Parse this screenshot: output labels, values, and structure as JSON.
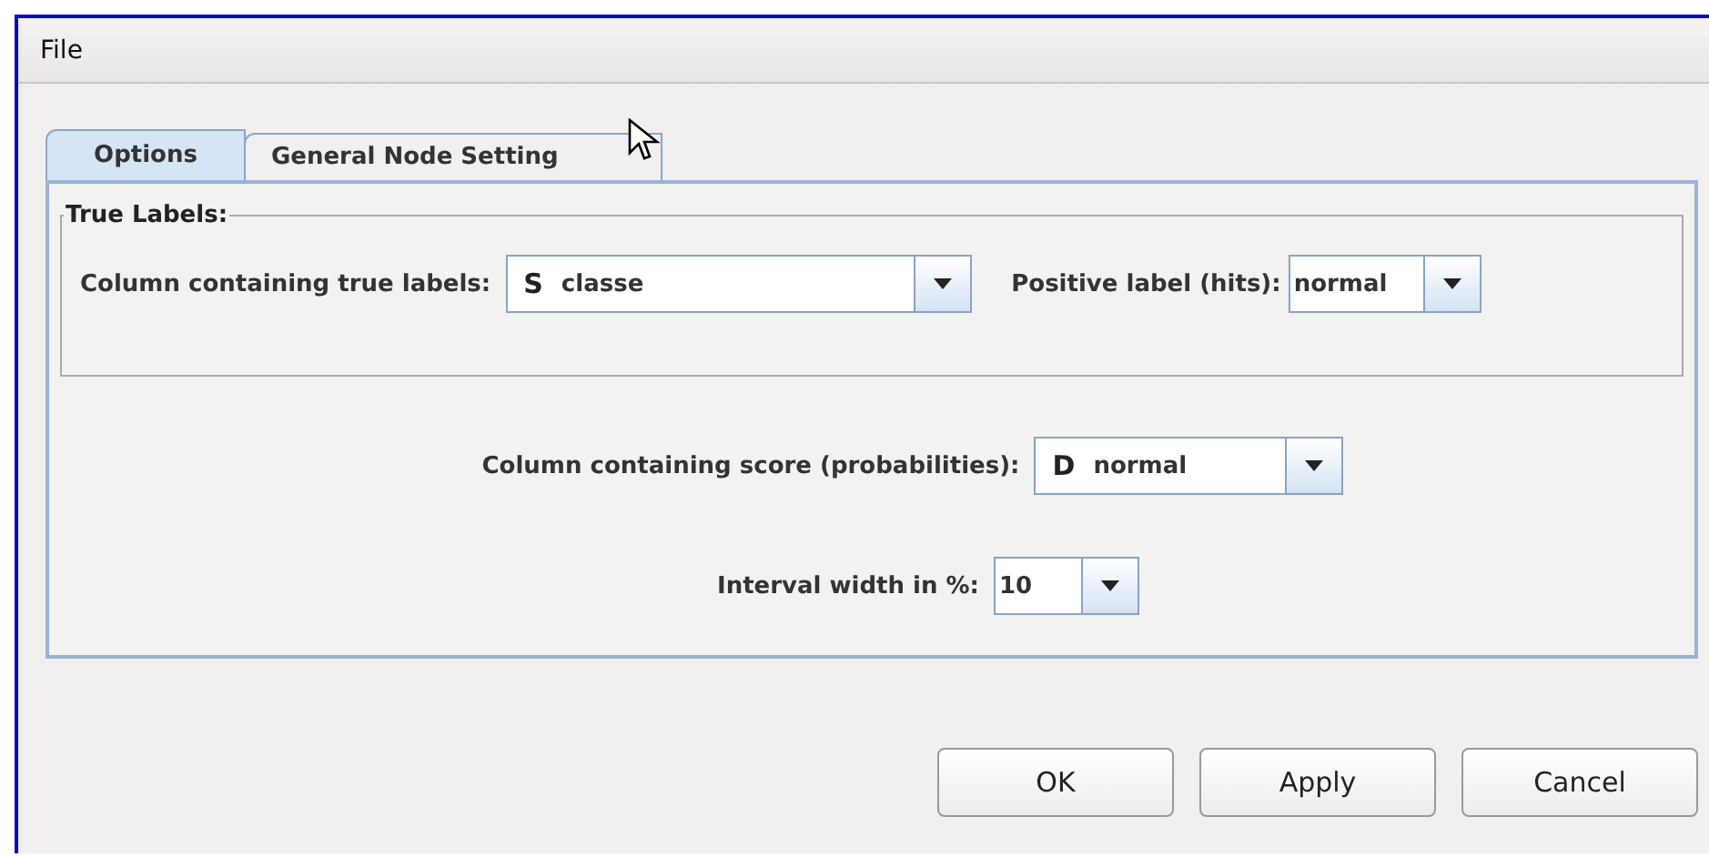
{
  "menu": [
    "File"
  ],
  "tabs": [
    {
      "label": "Options",
      "selected": true
    },
    {
      "label": "General Node Setting",
      "selected": false
    }
  ],
  "true_labels": {
    "title": "True Labels:",
    "column": {
      "label": "Column containing true labels:",
      "type": "S",
      "value": "classe"
    },
    "positive": {
      "label": "Positive label (hits):",
      "value": "normal"
    }
  },
  "score": {
    "label": "Column containing score (probabilities):",
    "type": "D",
    "value": "normal"
  },
  "interval": {
    "label": "Interval width in %:",
    "value": "10"
  },
  "buttons": [
    "OK",
    "Apply",
    "Cancel"
  ]
}
